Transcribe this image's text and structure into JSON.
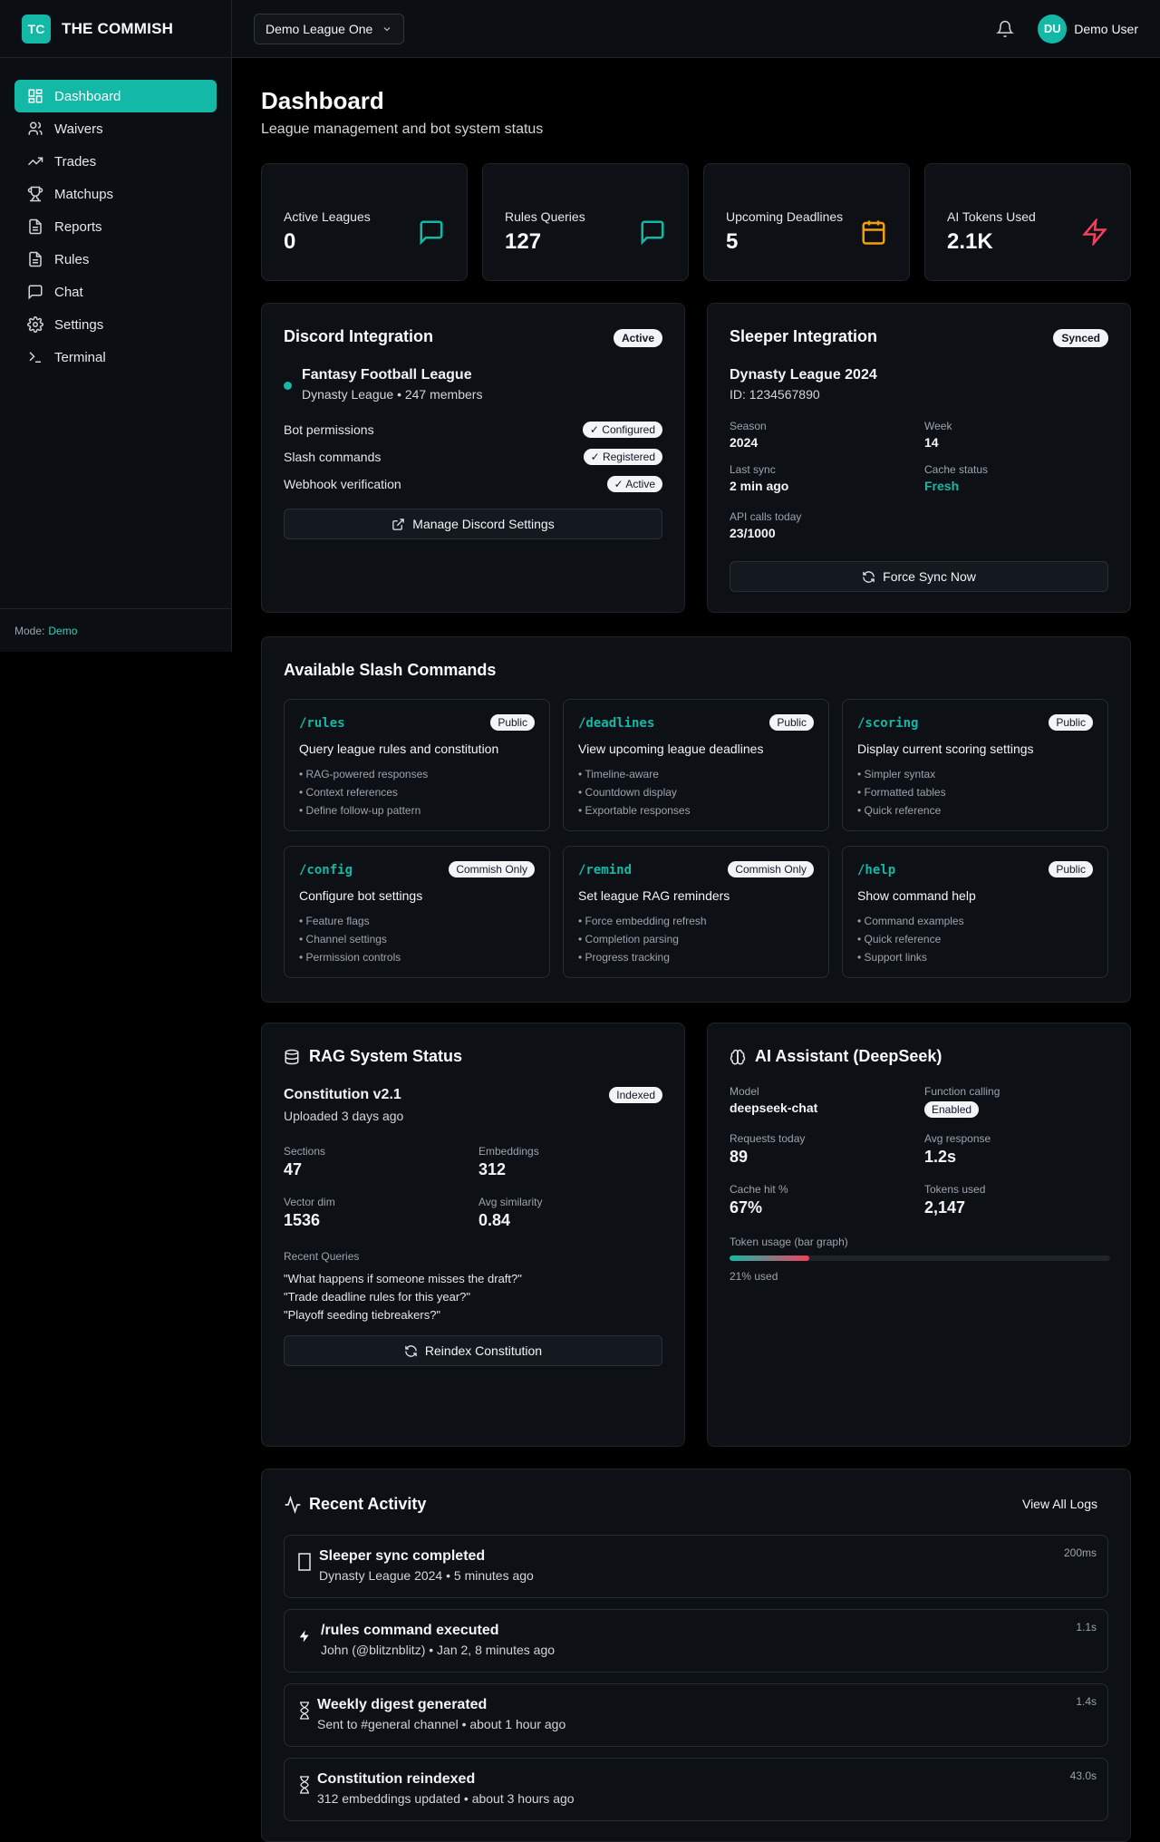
{
  "brand": {
    "logo": "TC",
    "name": "THE COMMISH"
  },
  "league_select": {
    "value": "Demo League One"
  },
  "user": {
    "initials": "DU",
    "name": "Demo User"
  },
  "sidebar": {
    "items": [
      {
        "label": "Dashboard",
        "icon": "dashboard-icon"
      },
      {
        "label": "Waivers",
        "icon": "users-icon"
      },
      {
        "label": "Trades",
        "icon": "trending-icon"
      },
      {
        "label": "Matchups",
        "icon": "trophy-icon"
      },
      {
        "label": "Reports",
        "icon": "file-icon"
      },
      {
        "label": "Rules",
        "icon": "file-icon"
      },
      {
        "label": "Chat",
        "icon": "chat-icon"
      },
      {
        "label": "Settings",
        "icon": "gear-icon"
      },
      {
        "label": "Terminal",
        "icon": "terminal-icon"
      }
    ],
    "mode_label": "Mode:",
    "mode_value": "Demo"
  },
  "page": {
    "title": "Dashboard",
    "subtitle": "League management and bot system status"
  },
  "stats": [
    {
      "label": "Active Leagues",
      "value": "0",
      "icon": "chat-icon",
      "color": "#14b8a6"
    },
    {
      "label": "Rules Queries",
      "value": "127",
      "icon": "chat-icon",
      "color": "#14b8a6"
    },
    {
      "label": "Upcoming Deadlines",
      "value": "5",
      "icon": "calendar-icon",
      "color": "#f59e0b"
    },
    {
      "label": "AI Tokens Used",
      "value": "2.1K",
      "icon": "bolt-icon",
      "color": "#f43f5e"
    }
  ],
  "discord": {
    "title": "Discord Integration",
    "badge": "Active",
    "server": "Fantasy Football League",
    "server_sub": "Dynasty League • 247 members",
    "checks": [
      {
        "label": "Bot permissions",
        "status": "Configured"
      },
      {
        "label": "Slash commands",
        "status": "Registered"
      },
      {
        "label": "Webhook verification",
        "status": "Active"
      }
    ],
    "button": "Manage Discord Settings"
  },
  "sleeper": {
    "title": "Sleeper Integration",
    "badge": "Synced",
    "league": "Dynasty League 2024",
    "id": "ID: 1234567890",
    "season_label": "Season",
    "season": "2024",
    "week_label": "Week",
    "week": "14",
    "last_sync_label": "Last sync",
    "last_sync": "2 min ago",
    "cache_label": "Cache status",
    "cache": "Fresh",
    "api_label": "API calls today",
    "api": "23/1000",
    "button": "Force Sync Now"
  },
  "commands": {
    "title": "Available Slash Commands",
    "items": [
      {
        "name": "/rules",
        "badge": "Public",
        "desc": "Query league rules and constitution",
        "bullets": [
          "• RAG-powered responses",
          "• Context references",
          "• Define follow-up pattern"
        ]
      },
      {
        "name": "/deadlines",
        "badge": "Public",
        "desc": "View upcoming league deadlines",
        "bullets": [
          "• Timeline-aware",
          "• Countdown display",
          "• Exportable responses"
        ]
      },
      {
        "name": "/scoring",
        "badge": "Public",
        "desc": "Display current scoring settings",
        "bullets": [
          "• Simpler syntax",
          "• Formatted tables",
          "• Quick reference"
        ]
      },
      {
        "name": "/config",
        "badge": "Commish Only",
        "desc": "Configure bot settings",
        "bullets": [
          "• Feature flags",
          "• Channel settings",
          "• Permission controls"
        ]
      },
      {
        "name": "/remind",
        "badge": "Commish Only",
        "desc": "Set league RAG reminders",
        "bullets": [
          "• Force embedding refresh",
          "• Completion parsing",
          "• Progress tracking"
        ]
      },
      {
        "name": "/help",
        "badge": "Public",
        "desc": "Show command help",
        "bullets": [
          "• Command examples",
          "• Quick reference",
          "• Support links"
        ]
      }
    ]
  },
  "rag": {
    "title": "RAG System Status",
    "doc": "Constitution v2.1",
    "badge": "Indexed",
    "uploaded": "Uploaded 3 days ago",
    "sections_label": "Sections",
    "sections": "47",
    "embeddings_label": "Embeddings",
    "embeddings": "312",
    "vector_label": "Vector dim",
    "vector": "1536",
    "similarity_label": "Avg similarity",
    "similarity": "0.84",
    "recent_label": "Recent Queries",
    "queries": [
      "\"What happens if someone misses the draft?\"",
      "\"Trade deadline rules for this year?\"",
      "\"Playoff seeding tiebreakers?\""
    ],
    "button": "Reindex Constitution"
  },
  "ai": {
    "title": "AI Assistant (DeepSeek)",
    "model_label": "Model",
    "model": "deepseek-chat",
    "fc_label": "Function calling",
    "fc": "Enabled",
    "requests_label": "Requests today",
    "requests": "89",
    "avg_label": "Avg response",
    "avg": "1.2s",
    "cache_label": "Cache hit %",
    "cache": "67%",
    "tokens_label": "Tokens used",
    "tokens": "2,147",
    "usage_label": "Token usage (bar graph)",
    "usage_fraction": 0.21,
    "usage_text": "21% used"
  },
  "activity": {
    "title": "Recent Activity",
    "view_all": "View All Logs",
    "items": [
      {
        "title": "Sleeper sync completed",
        "sub": "Dynasty League 2024 • 5 minutes ago",
        "dur": "200ms",
        "icon": "rect-icon"
      },
      {
        "title": "/rules command executed",
        "sub": "John (@blitznblitz) • Jan 2, 8 minutes ago",
        "dur": "1.1s",
        "icon": "bolt-icon"
      },
      {
        "title": "Weekly digest generated",
        "sub": "Sent to #general channel • about 1 hour ago",
        "dur": "1.4s",
        "icon": "hourglass-icon"
      },
      {
        "title": "Constitution reindexed",
        "sub": "312 embeddings updated • about 3 hours ago",
        "dur": "43.0s",
        "icon": "hourglass-icon"
      }
    ]
  }
}
